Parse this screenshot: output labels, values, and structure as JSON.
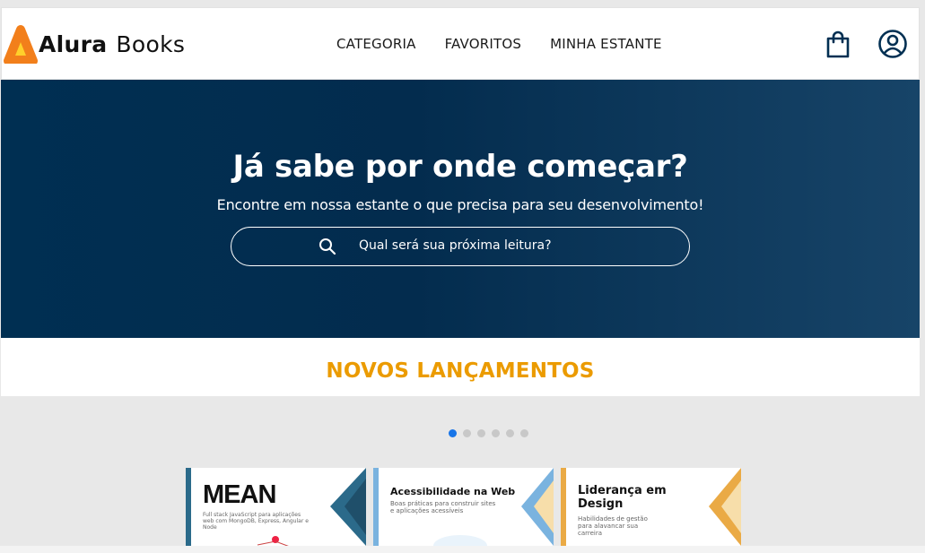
{
  "brand": {
    "name_bold": "Alura",
    "name_light": "Books",
    "logo_color": "#f27f1b"
  },
  "nav": {
    "items": [
      "CATEGORIA",
      "FAVORITOS",
      "MINHA ESTANTE"
    ]
  },
  "header_icons": {
    "bag": "shopping-bag-icon",
    "user": "user-account-icon"
  },
  "hero": {
    "title": "Já sabe por onde começar?",
    "subtitle": "Encontre em nossa estante o que precisa para seu desenvolvimento!",
    "search_placeholder": "Qual será sua próxima leitura?",
    "bg_color": "#002f52"
  },
  "releases": {
    "title": "NOVOS LANÇAMENTOS",
    "title_color": "#eb9b00"
  },
  "carousel": {
    "total_pages": 6,
    "active_index": 0,
    "active_color": "#1875e8"
  },
  "books": [
    {
      "title": "MEAN",
      "subtitle": "Full stack JavaScript para aplicações web com MongoDB, Express, Angular e Node",
      "accent": "#2b6a8a"
    },
    {
      "title": "Acessibilidade na Web",
      "subtitle": "Boas práticas para construir sites e aplicações acessíveis",
      "accent": "#7ab3df"
    },
    {
      "title": "Liderança em Design",
      "subtitle": "Habilidades de gestão para alavancar sua carreira",
      "accent": "#eaaa45"
    }
  ]
}
